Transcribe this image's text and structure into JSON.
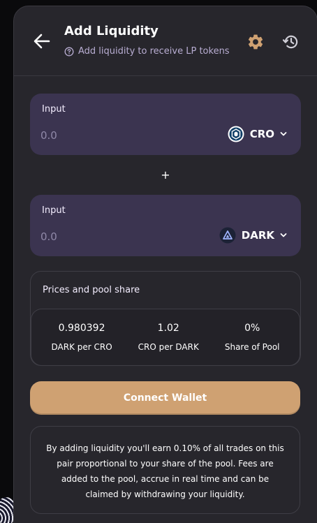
{
  "header": {
    "title": "Add Liquidity",
    "subtitle": "Add liquidity to receive LP tokens"
  },
  "icons": {
    "back": "arrow-left-icon",
    "help": "question-circle-icon",
    "settings": "gear-icon",
    "history": "history-icon",
    "chevron": "chevron-down-icon"
  },
  "inputs": [
    {
      "label": "Input",
      "placeholder": "0.0",
      "token": "CRO"
    },
    {
      "label": "Input",
      "placeholder": "0.0",
      "token": "DARK"
    }
  ],
  "plus_sign": "+",
  "prices": {
    "title": "Prices and pool share",
    "stats": [
      {
        "value": "0.980392",
        "label": "DARK per CRO"
      },
      {
        "value": "1.02",
        "label": "CRO per DARK"
      },
      {
        "value": "0%",
        "label": "Share of Pool"
      }
    ]
  },
  "connect_button": "Connect Wallet",
  "info_text": "By adding liquidity you'll earn 0.10% of all trades on this pair proportional to your share of the pool. Fees are added to the pool, accrue in real time and can be claimed by withdrawing your liquidity.",
  "colors": {
    "card_bg": "#27262c",
    "input_bg": "#3b3450",
    "accent": "#cfa172",
    "subtitle": "#b8add2"
  }
}
